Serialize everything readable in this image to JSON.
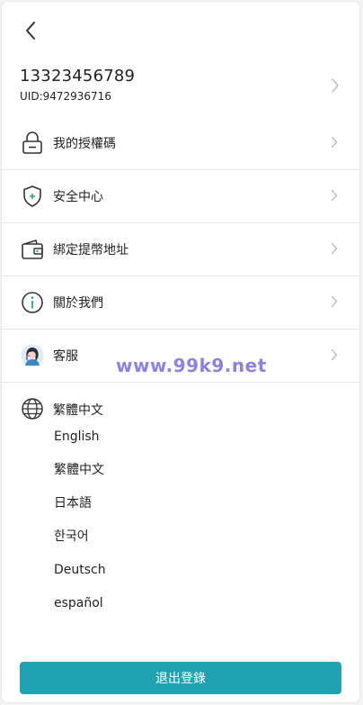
{
  "header": {
    "back_icon": "chevron-left-icon"
  },
  "profile": {
    "phone": "13323456789",
    "uid": "UID:9472936716"
  },
  "menu": {
    "items": [
      {
        "label": "我的授權碼",
        "icon": "lock-icon"
      },
      {
        "label": "安全中心",
        "icon": "shield-icon"
      },
      {
        "label": "綁定提幣地址",
        "icon": "wallet-icon"
      },
      {
        "label": "關於我們",
        "icon": "info-icon"
      },
      {
        "label": "客服",
        "icon": "customer-service-avatar-icon"
      }
    ]
  },
  "language": {
    "current": "繁體中文",
    "icon": "globe-icon",
    "options": [
      "English",
      "繁體中文",
      "日本語",
      "한국어",
      "Deutsch",
      "español"
    ]
  },
  "watermark": "www.99k9.net",
  "logout_label": "退出登錄",
  "colors": {
    "accent": "#1fa3b3",
    "shield_accent": "#1fa3b3",
    "watermark": "#8b82e3"
  }
}
